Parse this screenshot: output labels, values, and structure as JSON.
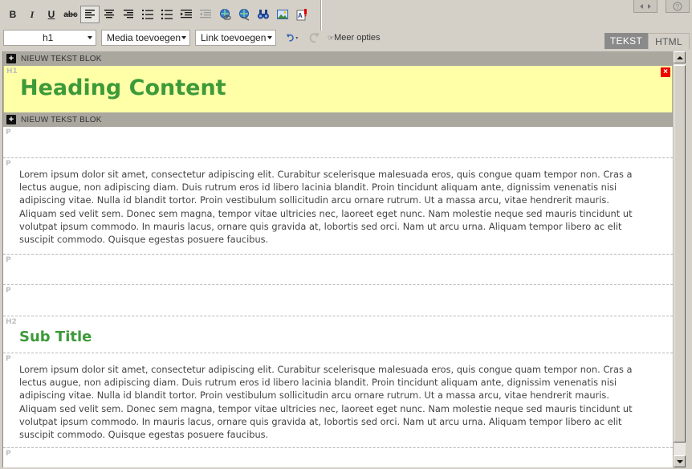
{
  "toolbar": {
    "format_select": "h1",
    "media_select": "Media toevoegen",
    "link_select": "Link toevoegen",
    "more_options": "Meer opties",
    "bold": "B",
    "italic": "I",
    "underline": "U",
    "strike": "abc"
  },
  "tabs": {
    "text": "TEKST",
    "html": "HTML"
  },
  "editor": {
    "new_block_label": "NIEUW TEKST BLOK",
    "heading_tag": "H1",
    "heading": "Heading Content",
    "delete_symbol": "×",
    "p_tag": "P",
    "h2_tag": "H2",
    "subtitle": "Sub Title",
    "paragraph": "Lorem ipsum dolor sit amet, consectetur adipiscing elit. Curabitur scelerisque malesuada eros, quis congue quam tempor non. Cras a lectus augue, non adipiscing diam. Duis rutrum eros id libero lacinia blandit. Proin tincidunt aliquam ante, dignissim venenatis nisi adipiscing vitae. Nulla id blandit tortor. Proin vestibulum sollicitudin arcu ornare rutrum. Ut a massa arcu, vitae hendrerit mauris. Aliquam sed velit sem. Donec sem magna, tempor vitae ultricies nec, laoreet eget nunc. Nam molestie neque sed mauris tincidunt ut volutpat ipsum commodo. In mauris lacus, ornare quis gravida at, lobortis sed orci. Nam ut arcu urna. Aliquam tempor libero ac elit suscipit commodo. Quisque egestas posuere faucibus."
  },
  "colors": {
    "heading": "#3d9a39",
    "heading_bg": "#ffffa8",
    "block_bar": "#aaa79f",
    "active_tab": "#8a8a8a"
  },
  "icons": [
    "bold-icon",
    "italic-icon",
    "underline-icon",
    "strikethrough-icon",
    "align-left-icon",
    "align-center-icon",
    "align-right-icon",
    "ordered-list-icon",
    "unordered-list-icon",
    "indent-icon",
    "outdent-icon",
    "insert-link-icon",
    "remove-link-icon",
    "find-icon",
    "insert-image-icon",
    "spellcheck-icon",
    "undo-icon",
    "redo-icon",
    "plus-icon",
    "close-icon"
  ]
}
